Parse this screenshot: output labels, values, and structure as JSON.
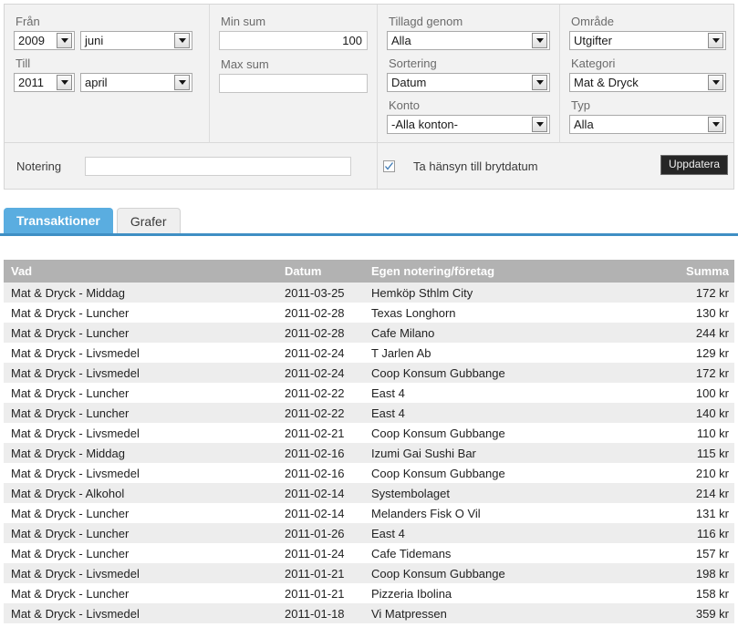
{
  "filters": {
    "fran": {
      "label": "Från",
      "year": "2009",
      "month": "juni"
    },
    "till": {
      "label": "Till",
      "year": "2011",
      "month": "april"
    },
    "min_sum": {
      "label": "Min sum",
      "value": "100",
      "placeholder": ""
    },
    "max_sum": {
      "label": "Max sum",
      "value": "",
      "placeholder": ""
    },
    "tillagd_genom": {
      "label": "Tillagd genom",
      "value": "Alla"
    },
    "sortering": {
      "label": "Sortering",
      "value": "Datum"
    },
    "konto": {
      "label": "Konto",
      "value": "-Alla konton-"
    },
    "omrade": {
      "label": "Område",
      "value": "Utgifter"
    },
    "kategori": {
      "label": "Kategori",
      "value": "Mat & Dryck"
    },
    "typ": {
      "label": "Typ",
      "value": "Alla"
    },
    "notering": {
      "label": "Notering",
      "value": "",
      "placeholder": ""
    },
    "brytdatum": {
      "label": "Ta hänsyn till brytdatum",
      "checked": true
    },
    "update_button": "Uppdatera"
  },
  "tabs": {
    "active": "Transaktioner",
    "items": [
      {
        "label": "Transaktioner",
        "active": true
      },
      {
        "label": "Grafer",
        "active": false
      }
    ]
  },
  "table": {
    "columns": [
      "Vad",
      "Datum",
      "Egen notering/företag",
      "Summa"
    ],
    "rows": [
      [
        "Mat & Dryck - Middag",
        "2011-03-25",
        "Hemköp Sthlm City",
        "172 kr"
      ],
      [
        "Mat & Dryck - Luncher",
        "2011-02-28",
        "Texas Longhorn",
        "130 kr"
      ],
      [
        "Mat & Dryck - Luncher",
        "2011-02-28",
        "Cafe Milano",
        "244 kr"
      ],
      [
        "Mat & Dryck - Livsmedel",
        "2011-02-24",
        "T Jarlen Ab",
        "129 kr"
      ],
      [
        "Mat & Dryck - Livsmedel",
        "2011-02-24",
        "Coop Konsum Gubbange",
        "172 kr"
      ],
      [
        "Mat & Dryck - Luncher",
        "2011-02-22",
        "East 4",
        "100 kr"
      ],
      [
        "Mat & Dryck - Luncher",
        "2011-02-22",
        "East 4",
        "140 kr"
      ],
      [
        "Mat & Dryck - Livsmedel",
        "2011-02-21",
        "Coop Konsum Gubbange",
        "110 kr"
      ],
      [
        "Mat & Dryck - Middag",
        "2011-02-16",
        "Izumi Gai Sushi Bar",
        "115 kr"
      ],
      [
        "Mat & Dryck - Livsmedel",
        "2011-02-16",
        "Coop Konsum Gubbange",
        "210 kr"
      ],
      [
        "Mat & Dryck - Alkohol",
        "2011-02-14",
        "Systembolaget",
        "214 kr"
      ],
      [
        "Mat & Dryck - Luncher",
        "2011-02-14",
        "Melanders Fisk O Vil",
        "131 kr"
      ],
      [
        "Mat & Dryck - Luncher",
        "2011-01-26",
        "East 4",
        "116 kr"
      ],
      [
        "Mat & Dryck - Luncher",
        "2011-01-24",
        "Cafe Tidemans",
        "157 kr"
      ],
      [
        "Mat & Dryck - Livsmedel",
        "2011-01-21",
        "Coop Konsum Gubbange",
        "198 kr"
      ],
      [
        "Mat & Dryck - Luncher",
        "2011-01-21",
        "Pizzeria Ibolina",
        "158 kr"
      ],
      [
        "Mat & Dryck - Livsmedel",
        "2011-01-18",
        "Vi Matpressen",
        "359 kr"
      ]
    ]
  },
  "colors": {
    "accent_blue": "#5aade0",
    "rule_blue": "#3f8fc4",
    "header_gray": "#b2b2b2",
    "panel_bg": "#f2f2f2",
    "row_stripe": "#ededed",
    "button_dark": "#262626"
  }
}
